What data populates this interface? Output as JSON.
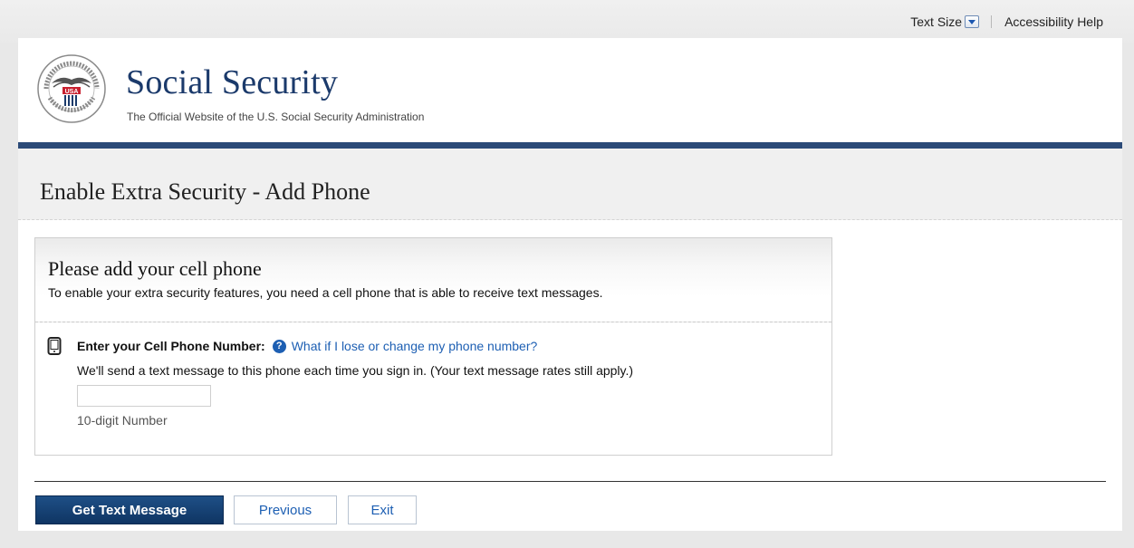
{
  "utility": {
    "text_size_label": "Text Size",
    "accessibility_label": "Accessibility Help"
  },
  "header": {
    "title": "Social Security",
    "subtitle": "The Official Website of the U.S. Social Security Administration",
    "logo_text": "SOCIAL SECURITY ADMINISTRATION USA"
  },
  "page": {
    "title": "Enable Extra Security - Add Phone"
  },
  "card": {
    "title": "Please add your cell phone",
    "description": "To enable your extra security features, you need a cell phone that is able to receive text messages.",
    "phone_label": "Enter your Cell Phone Number:",
    "help_link": "What if I lose or change my phone number?",
    "help_icon_glyph": "?",
    "phone_description": "We'll send a text message to this phone each time you sign in. (Your text message rates still apply.)",
    "phone_value": "",
    "phone_placeholder": "",
    "phone_hint": "10-digit Number"
  },
  "buttons": {
    "primary": "Get Text Message",
    "previous": "Previous",
    "exit": "Exit"
  },
  "colors": {
    "brand_navy": "#1b3a6b",
    "header_rule": "#2b4a78",
    "link_blue": "#1d5fb3",
    "primary_button": "#0f3563"
  }
}
